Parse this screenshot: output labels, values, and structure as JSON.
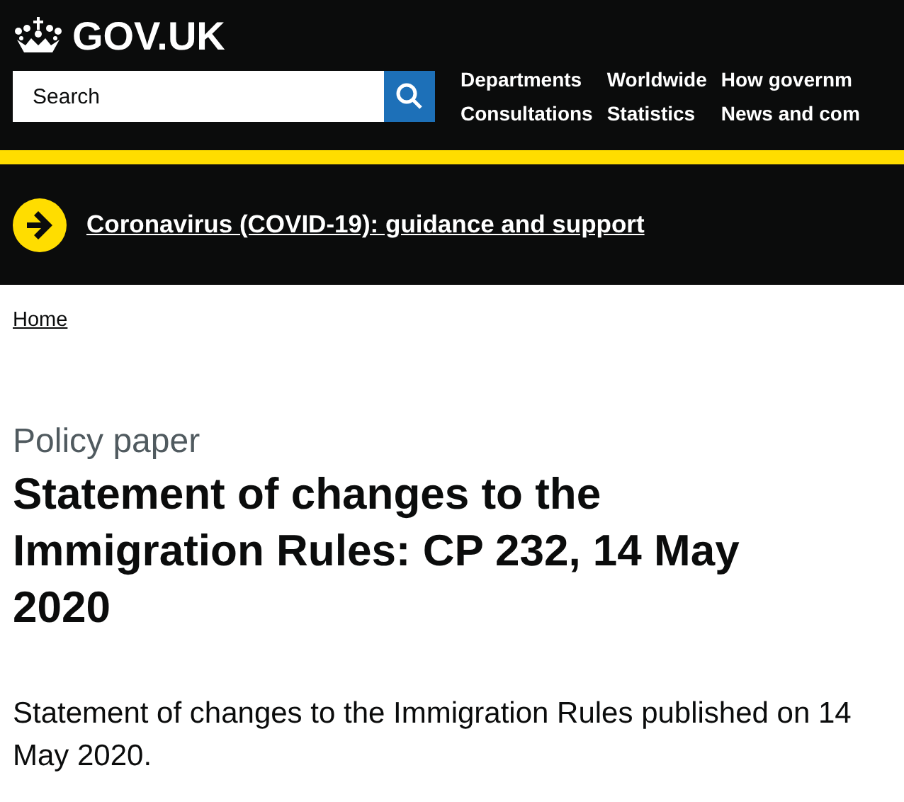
{
  "header": {
    "logo": "GOV.UK",
    "search": {
      "placeholder": "Search"
    },
    "nav": [
      {
        "label": "Departments"
      },
      {
        "label": "Worldwide"
      },
      {
        "label": "How governm"
      },
      {
        "label": "Consultations"
      },
      {
        "label": "Statistics"
      },
      {
        "label": "News and com"
      }
    ]
  },
  "banner": {
    "link": "Coronavirus (COVID-19): guidance and support"
  },
  "breadcrumbs": [
    {
      "label": "Home"
    }
  ],
  "caption": "Policy paper",
  "title": "Statement of changes to the Immigration Rules: CP 232, 14 May 2020",
  "summary": "Statement of changes to the Immigration Rules published on 14 May 2020."
}
